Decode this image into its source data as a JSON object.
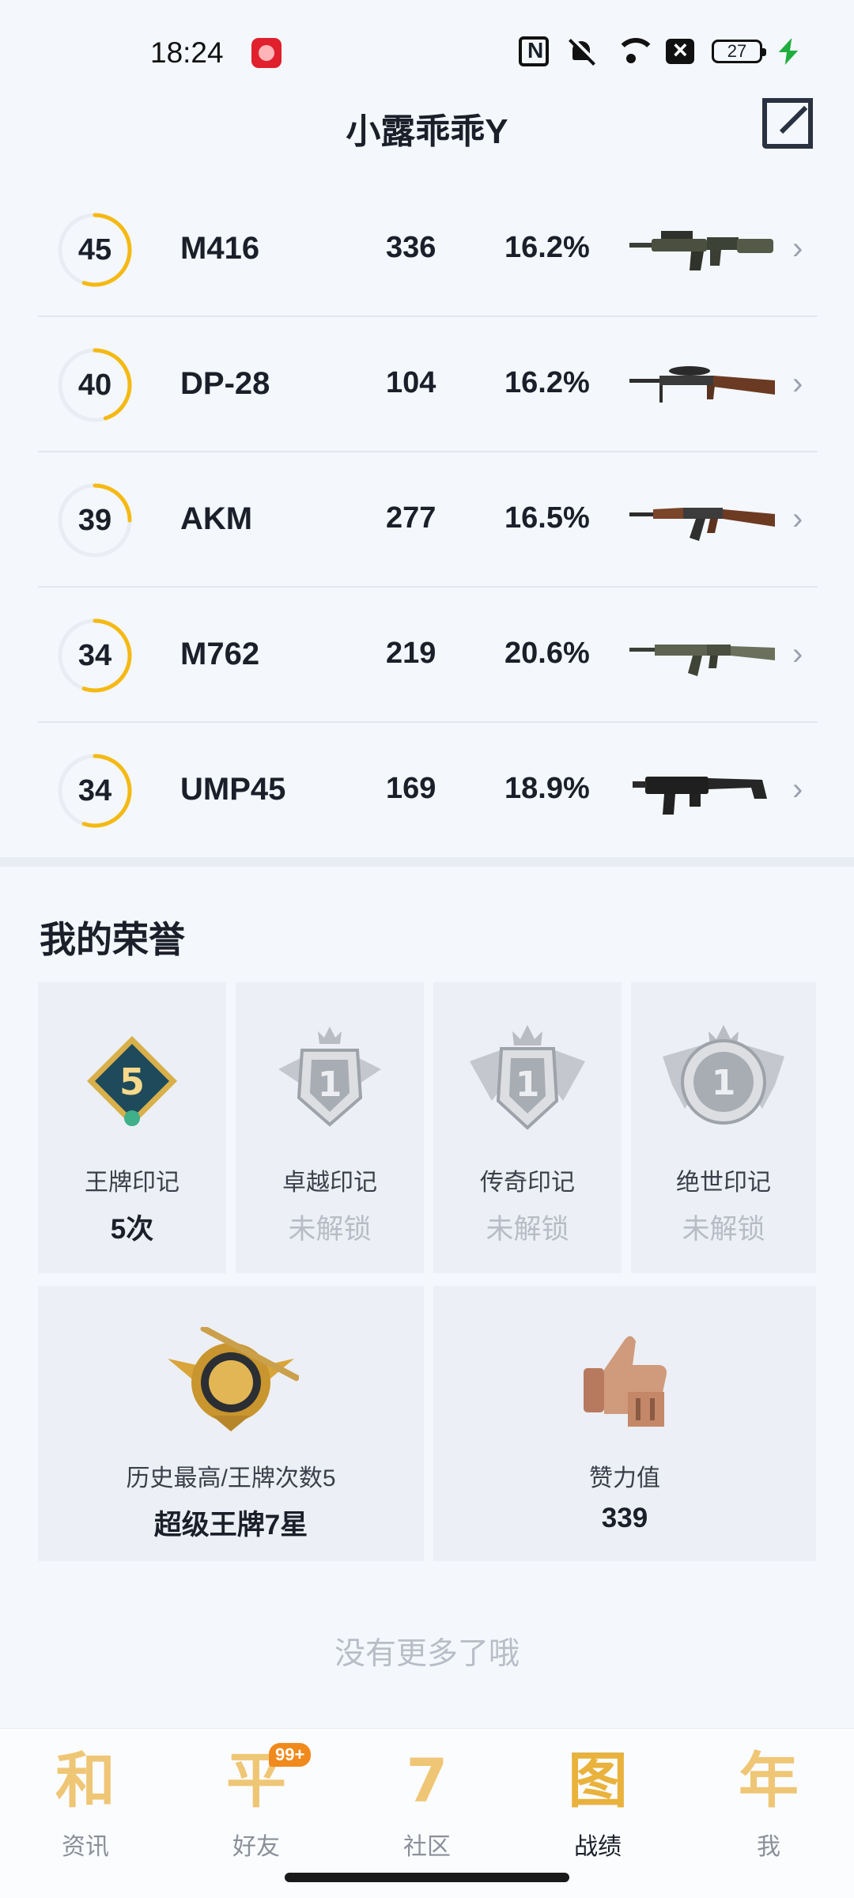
{
  "status_bar": {
    "time": "18:24",
    "battery": "27"
  },
  "header": {
    "title": "小露乖乖Y"
  },
  "weapons": [
    {
      "level": "45",
      "level_progress": 0.55,
      "name": "M416",
      "kills": "336",
      "rate": "16.2%",
      "image": "m416-rifle"
    },
    {
      "level": "40",
      "level_progress": 0.45,
      "name": "DP-28",
      "kills": "104",
      "rate": "16.2%",
      "image": "dp28-lmg"
    },
    {
      "level": "39",
      "level_progress": 0.25,
      "name": "AKM",
      "kills": "277",
      "rate": "16.5%",
      "image": "akm-rifle"
    },
    {
      "level": "34",
      "level_progress": 0.55,
      "name": "M762",
      "kills": "219",
      "rate": "20.6%",
      "image": "m762-rifle"
    },
    {
      "level": "34",
      "level_progress": 0.55,
      "name": "UMP45",
      "kills": "169",
      "rate": "18.9%",
      "image": "ump45-smg"
    }
  ],
  "honors": {
    "title": "我的荣誉",
    "marks": [
      {
        "label": "王牌印记",
        "value": "5次",
        "badge_number": "5",
        "locked": false
      },
      {
        "label": "卓越印记",
        "value": "未解锁",
        "badge_number": "1",
        "locked": true
      },
      {
        "label": "传奇印记",
        "value": "未解锁",
        "badge_number": "1",
        "locked": true
      },
      {
        "label": "绝世印记",
        "value": "未解锁",
        "badge_number": "1",
        "locked": true
      }
    ],
    "best": {
      "label": "历史最高/王牌次数5",
      "value": "超级王牌7星"
    },
    "likes": {
      "label": "赞力值",
      "value": "339"
    }
  },
  "footer": {
    "no_more": "没有更多了哦"
  },
  "nav": {
    "items": [
      {
        "glyph": "和",
        "label": "资讯",
        "active": false
      },
      {
        "glyph": "平",
        "label": "好友",
        "active": false,
        "badge": "99+"
      },
      {
        "glyph": "7",
        "label": "社区",
        "active": false
      },
      {
        "glyph": "图",
        "label": "战绩",
        "active": true
      },
      {
        "glyph": "年",
        "label": "我",
        "active": false
      }
    ]
  },
  "colors": {
    "accent": "#f5b912",
    "ring_track": "#e9ecf2",
    "nav_gold": "#efc675",
    "badge_orange": "#f08a1c"
  }
}
